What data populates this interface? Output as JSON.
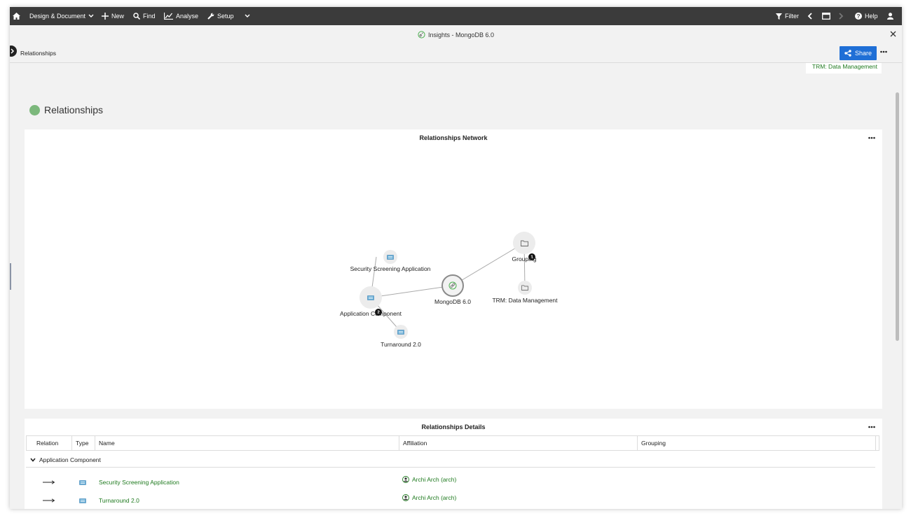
{
  "colors": {
    "topbar": "#3b3b3b",
    "accent": "#1f6fd6",
    "link_green": "#1f7a1f",
    "status_dot": "#7cb87c"
  },
  "topbar": {
    "home_icon": "home-icon",
    "design_document": "Design & Document",
    "new": "New",
    "find": "Find",
    "analyse": "Analyse",
    "setup": "Setup",
    "filter": "Filter",
    "help": "Help"
  },
  "window": {
    "title": "Insights - MongoDB 6.0"
  },
  "subbar": {
    "breadcrumb": "Relationships",
    "share_label": "Share"
  },
  "tag": "TRM: Data Management",
  "section": {
    "title": "Relationships"
  },
  "network": {
    "title": "Relationships Network",
    "nodes": [
      {
        "label": "Security Screening Application"
      },
      {
        "label": "Application Component",
        "badge": "2"
      },
      {
        "label": "Turnaround 2.0"
      },
      {
        "label": "MongoDB 6.0"
      },
      {
        "label": "Grouping",
        "badge": "1"
      },
      {
        "label": "TRM: Data Management"
      }
    ]
  },
  "details": {
    "title": "Relationships Details",
    "columns": [
      "Relation",
      "Type",
      "Name",
      "Affiliation",
      "Grouping"
    ],
    "group_label": "Application Component",
    "rows": [
      {
        "name": "Security Screening Application",
        "affiliation": "Archi Arch (arch)"
      },
      {
        "name": "Turnaround 2.0",
        "affiliation": "Archi Arch (arch)"
      }
    ]
  }
}
